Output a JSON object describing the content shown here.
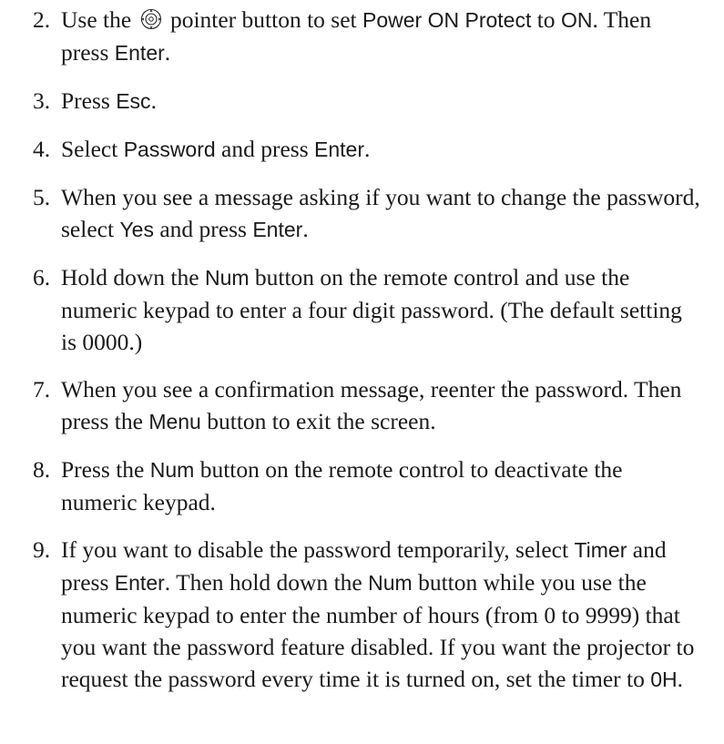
{
  "steps": [
    {
      "number": "2.",
      "segments": [
        {
          "t": "Use the "
        },
        {
          "t": "",
          "icon": "pointer-button-icon"
        },
        {
          "t": " pointer button to set "
        },
        {
          "t": "Power ON Protect",
          "ui": true
        },
        {
          "t": " to "
        },
        {
          "t": "ON",
          "ui": true
        },
        {
          "t": ". Then press "
        },
        {
          "t": "Enter",
          "ui": true
        },
        {
          "t": "."
        }
      ]
    },
    {
      "number": "3.",
      "segments": [
        {
          "t": "Press "
        },
        {
          "t": "Esc",
          "ui": true
        },
        {
          "t": "."
        }
      ]
    },
    {
      "number": "4.",
      "segments": [
        {
          "t": "Select "
        },
        {
          "t": "Password",
          "ui": true
        },
        {
          "t": " and press "
        },
        {
          "t": "Enter",
          "ui": true
        },
        {
          "t": "."
        }
      ]
    },
    {
      "number": "5.",
      "segments": [
        {
          "t": "When you see a message asking if you want to change the password, select "
        },
        {
          "t": "Yes",
          "ui": true
        },
        {
          "t": " and press "
        },
        {
          "t": "Enter",
          "ui": true
        },
        {
          "t": "."
        }
      ]
    },
    {
      "number": "6.",
      "segments": [
        {
          "t": "Hold down the "
        },
        {
          "t": "Num",
          "ui": true
        },
        {
          "t": " button on the remote control and use the numeric keypad to enter a four digit password. (The default setting is 0000.)"
        }
      ]
    },
    {
      "number": "7.",
      "segments": [
        {
          "t": "When you see a confirmation message, reenter the password. Then press the "
        },
        {
          "t": "Menu",
          "ui": true
        },
        {
          "t": " button to exit the screen."
        }
      ]
    },
    {
      "number": "8.",
      "segments": [
        {
          "t": "Press the "
        },
        {
          "t": "Num",
          "ui": true
        },
        {
          "t": " button on the remote control to deactivate the numeric keypad."
        }
      ]
    },
    {
      "number": "9.",
      "segments": [
        {
          "t": "If you want to disable the password temporarily, select "
        },
        {
          "t": "Timer",
          "ui": true
        },
        {
          "t": " and press "
        },
        {
          "t": "Enter",
          "ui": true
        },
        {
          "t": ". Then hold down the "
        },
        {
          "t": "Num",
          "ui": true
        },
        {
          "t": " button while you use the numeric keypad to enter the number of hours (from 0 to 9999) that you want the password feature disabled. If you want the projector to request the password every time it is turned on, set the timer to "
        },
        {
          "t": "0H",
          "ui": true
        },
        {
          "t": "."
        }
      ]
    }
  ]
}
